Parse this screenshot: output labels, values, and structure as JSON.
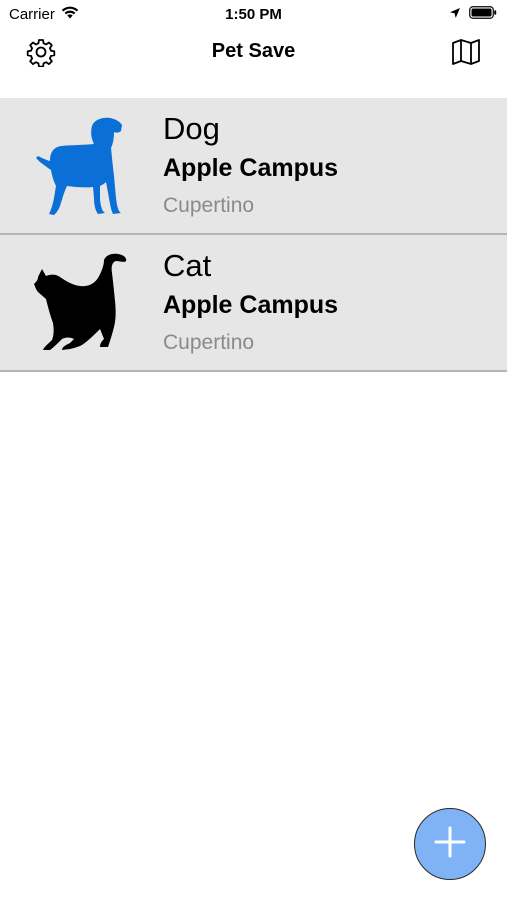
{
  "status_bar": {
    "carrier": "Carrier",
    "time": "1:50 PM",
    "icons": [
      "wifi-icon",
      "location-arrow-icon",
      "battery-icon"
    ]
  },
  "nav": {
    "title": "Pet Save",
    "left_icon": "gear-icon",
    "right_icon": "map-icon"
  },
  "pets": [
    {
      "name": "Dog",
      "place": "Apple Campus",
      "city": "Cupertino",
      "icon": "dog-icon",
      "color": "#0a6fd6"
    },
    {
      "name": "Cat",
      "place": "Apple Campus",
      "city": "Cupertino",
      "icon": "cat-icon",
      "color": "#000000"
    }
  ],
  "fab": {
    "icon": "plus-icon",
    "color": "#7fb3f5"
  }
}
